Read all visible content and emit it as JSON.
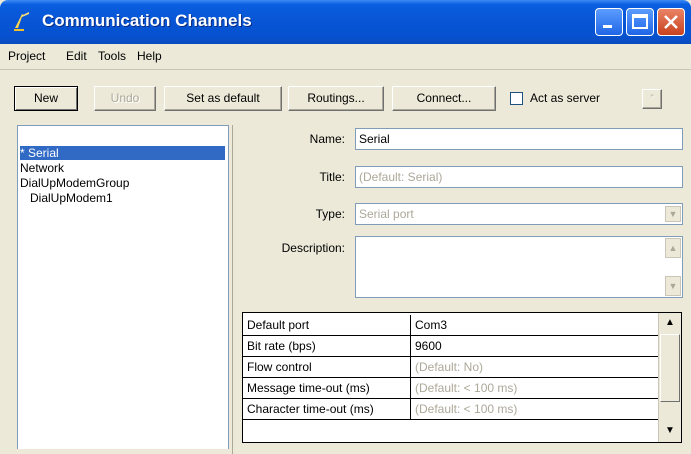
{
  "window": {
    "title": "Communication Channels"
  },
  "menu": {
    "items": [
      "Project",
      "Edit",
      "Tools",
      "Help"
    ]
  },
  "toolbar": {
    "new_label": "New",
    "undo_label": "Undo",
    "set_default_label": "Set as default",
    "routings_label": "Routings...",
    "connect_label": "Connect...",
    "act_as_server_label": "Act as server",
    "server_options_label": "\""
  },
  "tree": {
    "items": [
      {
        "label": "* Serial",
        "selected": true
      },
      {
        "label": "Network",
        "selected": false
      },
      {
        "label": "DialUpModemGroup",
        "selected": false
      },
      {
        "label": "DialUpModem1",
        "selected": false
      }
    ]
  },
  "form": {
    "name_label": "Name:",
    "name_value": "Serial",
    "title_label": "Title:",
    "title_value": "(Default: Serial)",
    "type_label": "Type:",
    "type_value": "Serial port",
    "description_label": "Description:",
    "description_value": ""
  },
  "properties": [
    {
      "name": "Default port",
      "value": "Com3",
      "is_default": false
    },
    {
      "name": "Bit rate (bps)",
      "value": "9600",
      "is_default": false
    },
    {
      "name": "Flow control",
      "value": "(Default: No)",
      "is_default": true
    },
    {
      "name": "Message time-out (ms)",
      "value": "(Default: < 100 ms)",
      "is_default": true
    },
    {
      "name": "Character time-out (ms)",
      "value": "(Default: < 100 ms)",
      "is_default": true
    }
  ],
  "colors": {
    "titlebar": "#0756d6",
    "selection": "#316ac5",
    "disabled_text": "#aca899"
  }
}
